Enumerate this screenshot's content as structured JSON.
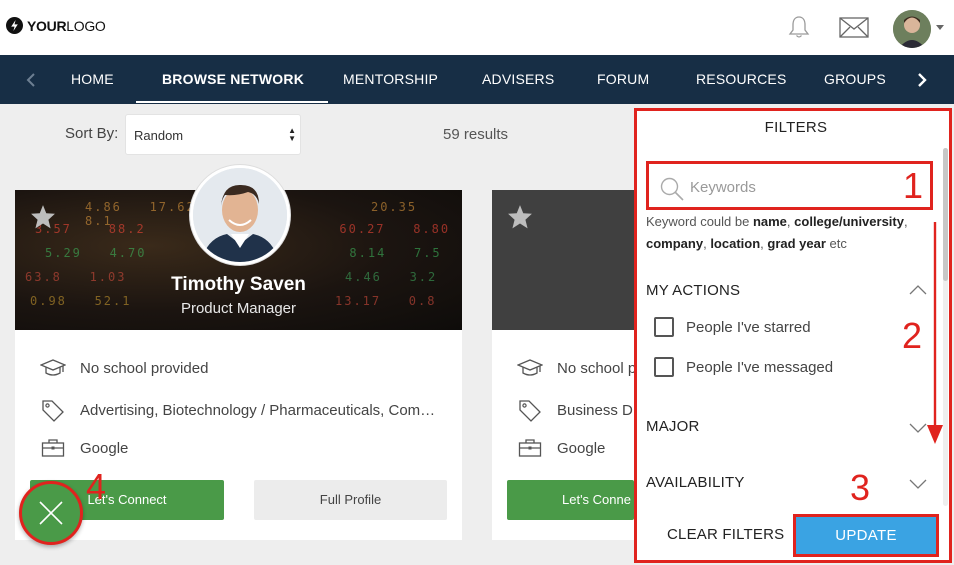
{
  "logo": {
    "bold": "YOUR",
    "light": "LOGO"
  },
  "nav": {
    "items": [
      "HOME",
      "BROWSE NETWORK",
      "MENTORSHIP",
      "ADVISERS",
      "FORUM",
      "RESOURCES",
      "GROUPS"
    ],
    "active": "BROWSE NETWORK",
    "prev_icon": "chevron-left-icon",
    "next_icon": "chevron-right-icon"
  },
  "sort": {
    "label": "Sort By:",
    "value": "Random"
  },
  "results": "59 results",
  "cards": [
    {
      "name": "Timothy Saven",
      "title": "Product Manager",
      "school": "No school provided",
      "industries": "Advertising, Biotechnology / Pharmaceuticals, Com…",
      "company": "Google",
      "connect_label": "Let's Connect",
      "profile_label": "Full Profile"
    },
    {
      "school": "No school p",
      "industries": "Business D",
      "company": "Google",
      "connect_label": "Let's Conne"
    }
  ],
  "filters": {
    "title": "FILTERS",
    "keyword_placeholder": "Keywords",
    "help": {
      "prefix": "Keyword could be ",
      "terms": [
        "name",
        "college/university",
        "company",
        "location",
        "grad year"
      ],
      "suffix": " etc"
    },
    "sections": [
      {
        "label": "MY ACTIONS",
        "expanded": true,
        "options": [
          "People I've starred",
          "People I've messaged"
        ]
      },
      {
        "label": "MAJOR",
        "expanded": false
      },
      {
        "label": "AVAILABILITY",
        "expanded": false
      }
    ],
    "clear_label": "CLEAR FILTERS",
    "update_label": "UPDATE"
  },
  "annotations": [
    "1",
    "2",
    "3",
    "4"
  ],
  "colors": {
    "navbar": "#172e45",
    "connect_green": "#4a9a48",
    "update_blue": "#3aa3e3",
    "annotation_red": "#e0231e",
    "page_bg": "#eeeeee"
  }
}
